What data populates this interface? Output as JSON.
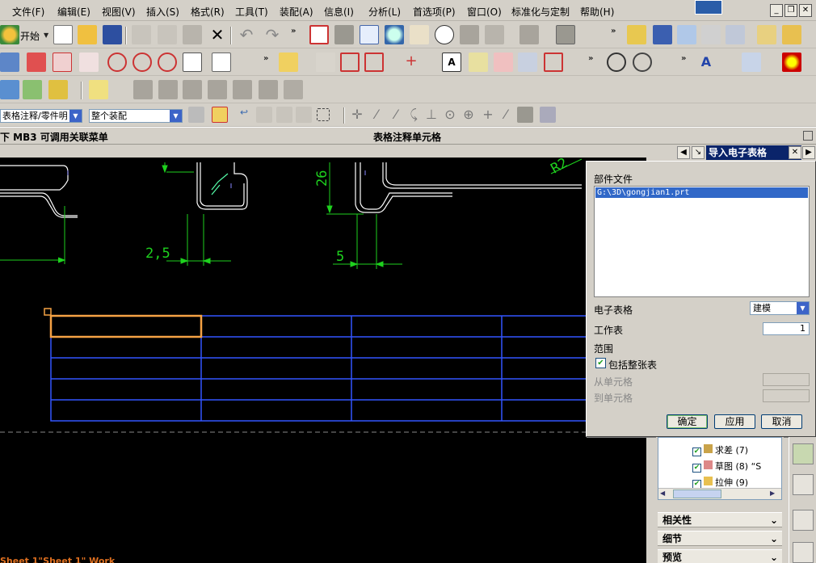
{
  "menu": {
    "items": [
      {
        "label": "文件(F)"
      },
      {
        "label": "编辑(E)"
      },
      {
        "label": "视图(V)"
      },
      {
        "label": "插入(S)"
      },
      {
        "label": "格式(R)"
      },
      {
        "label": "工具(T)"
      },
      {
        "label": "装配(A)"
      },
      {
        "label": "信息(I)"
      },
      {
        "label": "分析(L)"
      },
      {
        "label": "首选项(P)"
      },
      {
        "label": "窗口(O)"
      },
      {
        "label": "标准化与定制"
      },
      {
        "label": "帮助(H)"
      }
    ]
  },
  "toolbar": {
    "start_label": "开始"
  },
  "selection_bar": {
    "filter_value": "表格注释/零件明",
    "scope_value": "整个装配"
  },
  "status": {
    "left": "下 MB3 可调用关联菜单",
    "center": "表格注释单元格"
  },
  "drawing": {
    "dims": [
      "2,5",
      "5",
      "26",
      "R2"
    ]
  },
  "dialog": {
    "title": "导入电子表格",
    "part_file_label": "部件文件",
    "part_file_path": "G:\\3D\\gongjian1.prt",
    "spreadsheet_label": "电子表格",
    "spreadsheet_value": "建模",
    "worksheet_label": "工作表",
    "worksheet_value": "1",
    "range_label": "范围",
    "include_whole_label": "包括整张表",
    "from_cell_label": "从单元格",
    "to_cell_label": "到单元格",
    "ok_label": "确定",
    "apply_label": "应用",
    "cancel_label": "取消"
  },
  "navigator": {
    "tree": [
      {
        "label": "求差 (7)"
      },
      {
        "label": "草图 (8) “S"
      },
      {
        "label": "拉伸 (9)"
      }
    ],
    "sections": [
      {
        "label": "相关性"
      },
      {
        "label": "细节"
      },
      {
        "label": "预览"
      }
    ]
  },
  "sheet_label": "Sheet 1\"Sheet 1\" Work"
}
